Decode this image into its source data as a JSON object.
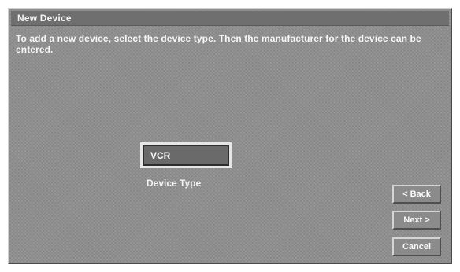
{
  "window": {
    "title": "New Device"
  },
  "instructions": "To add a new device, select the device type. Then the manufacturer for the device can be entered.",
  "device_type": {
    "value": "VCR",
    "label": "Device Type"
  },
  "buttons": {
    "back": "< Back",
    "next": "Next >",
    "cancel": "Cancel"
  }
}
